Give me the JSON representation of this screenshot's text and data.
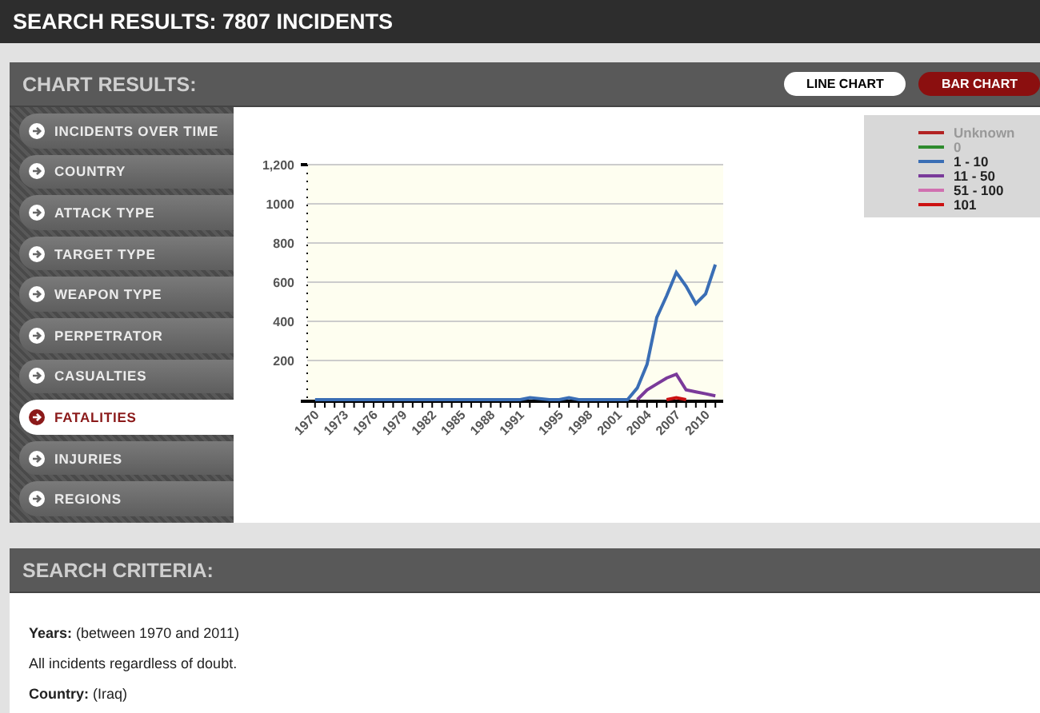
{
  "page_title": "SEARCH RESULTS: 7807 INCIDENTS",
  "chart_panel": {
    "title": "CHART RESULTS:",
    "view_buttons": [
      {
        "label": "LINE CHART",
        "selected": true
      },
      {
        "label": "BAR CHART",
        "selected": false
      }
    ],
    "sidebar": {
      "items": [
        {
          "label": "INCIDENTS OVER TIME",
          "selected": false
        },
        {
          "label": "COUNTRY",
          "selected": false
        },
        {
          "label": "ATTACK TYPE",
          "selected": false
        },
        {
          "label": "TARGET TYPE",
          "selected": false
        },
        {
          "label": "WEAPON TYPE",
          "selected": false
        },
        {
          "label": "PERPETRATOR",
          "selected": false
        },
        {
          "label": "CASUALTIES",
          "selected": false
        },
        {
          "label": "FATALITIES",
          "selected": true
        },
        {
          "label": "INJURIES",
          "selected": false
        },
        {
          "label": "REGIONS",
          "selected": false
        }
      ]
    },
    "legend": [
      {
        "label": "Unknown",
        "color": "#b22222",
        "dimmed": true
      },
      {
        "label": "0",
        "color": "#2e8b2e",
        "dimmed": true
      },
      {
        "label": "1 - 10",
        "color": "#3a6eb5",
        "dimmed": false
      },
      {
        "label": "11 - 50",
        "color": "#7a3a9a",
        "dimmed": false
      },
      {
        "label": "51 - 100",
        "color": "#d070b0",
        "dimmed": false
      },
      {
        "label": "101",
        "color": "#cc1111",
        "dimmed": false
      }
    ],
    "chart_data": {
      "type": "line",
      "x": [
        1970,
        1971,
        1972,
        1973,
        1974,
        1975,
        1976,
        1977,
        1978,
        1979,
        1980,
        1981,
        1982,
        1983,
        1984,
        1985,
        1986,
        1987,
        1988,
        1989,
        1990,
        1991,
        1992,
        1994,
        1995,
        1996,
        1997,
        1998,
        1999,
        2000,
        2001,
        2002,
        2003,
        2004,
        2005,
        2006,
        2007,
        2008,
        2009,
        2010,
        2011
      ],
      "grid": true,
      "xlim": [
        1969.2,
        2011.8
      ],
      "ylim": [
        0,
        1200
      ],
      "yticks": [
        200,
        400,
        600,
        800,
        1000,
        {
          "value": 1200,
          "label": "1,200"
        }
      ],
      "xticks": [
        1970,
        1973,
        1976,
        1979,
        1982,
        1985,
        1988,
        1991,
        1995,
        1998,
        2001,
        2004,
        2007,
        2010
      ],
      "series": [
        {
          "color": "#cc1111",
          "values": [
            null,
            null,
            null,
            null,
            null,
            null,
            null,
            null,
            null,
            null,
            null,
            null,
            null,
            null,
            null,
            null,
            null,
            null,
            null,
            null,
            null,
            null,
            null,
            null,
            null,
            null,
            null,
            null,
            null,
            null,
            null,
            null,
            null,
            null,
            null,
            0,
            10,
            0,
            null,
            null,
            null
          ]
        },
        {
          "color": "#7a3a9a",
          "values": [
            null,
            null,
            null,
            null,
            null,
            null,
            null,
            null,
            null,
            null,
            null,
            null,
            null,
            null,
            null,
            null,
            null,
            null,
            null,
            null,
            null,
            null,
            null,
            null,
            null,
            null,
            null,
            null,
            null,
            null,
            null,
            null,
            0,
            50,
            80,
            110,
            130,
            50,
            40,
            30,
            20
          ]
        },
        {
          "color": "#3a6eb5",
          "values": [
            0,
            0,
            0,
            0,
            0,
            0,
            0,
            0,
            0,
            0,
            0,
            0,
            0,
            0,
            0,
            0,
            0,
            0,
            0,
            0,
            0,
            0,
            10,
            0,
            0,
            10,
            0,
            0,
            0,
            0,
            0,
            0,
            60,
            180,
            420,
            530,
            650,
            580,
            490,
            540,
            690
          ]
        }
      ]
    }
  },
  "criteria_panel": {
    "title": "SEARCH CRITERIA:",
    "lines": [
      "**Years:** (between 1970 and 2011)",
      "All incidents regardless of doubt.",
      "**Country:** (Iraq)"
    ]
  }
}
